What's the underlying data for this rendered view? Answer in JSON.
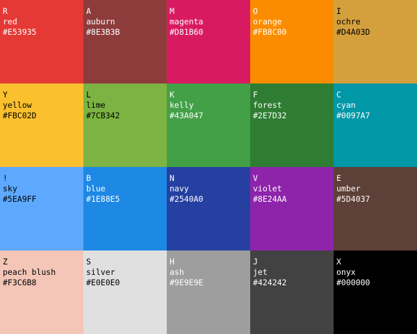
{
  "palette": {
    "swatches": [
      {
        "key": "R",
        "name": "red",
        "hex": "#E53935",
        "text_color": "#FFFFFF"
      },
      {
        "key": "A",
        "name": "auburn",
        "hex": "#8E3B3B",
        "text_color": "#FFFFFF"
      },
      {
        "key": "M",
        "name": "magenta",
        "hex": "#D81B60",
        "text_color": "#FFFFFF"
      },
      {
        "key": "O",
        "name": "orange",
        "hex": "#FB8C00",
        "text_color": "#FFFFFF"
      },
      {
        "key": "I",
        "name": "ochre",
        "hex": "#D4A03D",
        "text_color": "#000000"
      },
      {
        "key": "Y",
        "name": "yellow",
        "hex": "#FBC02D",
        "text_color": "#000000"
      },
      {
        "key": "L",
        "name": "lime",
        "hex": "#7CB342",
        "text_color": "#000000"
      },
      {
        "key": "K",
        "name": "kelly",
        "hex": "#43A047",
        "text_color": "#FFFFFF"
      },
      {
        "key": "F",
        "name": "forest",
        "hex": "#2E7D32",
        "text_color": "#FFFFFF"
      },
      {
        "key": "C",
        "name": "cyan",
        "hex": "#0097A7",
        "text_color": "#FFFFFF"
      },
      {
        "key": "!",
        "name": "sky",
        "hex": "#5EA9FF",
        "text_color": "#000000"
      },
      {
        "key": "B",
        "name": "blue",
        "hex": "#1E88E5",
        "text_color": "#FFFFFF"
      },
      {
        "key": "N",
        "name": "navy",
        "hex": "#2540A0",
        "text_color": "#FFFFFF"
      },
      {
        "key": "V",
        "name": "violet",
        "hex": "#8E24AA",
        "text_color": "#FFFFFF"
      },
      {
        "key": "E",
        "name": "umber",
        "hex": "#5D4037",
        "text_color": "#FFFFFF"
      },
      {
        "key": "Z",
        "name": "peach blush",
        "hex": "#F3C6B8",
        "text_color": "#000000"
      },
      {
        "key": "S",
        "name": "silver",
        "hex": "#E0E0E0",
        "text_color": "#000000"
      },
      {
        "key": "H",
        "name": "ash",
        "hex": "#9E9E9E",
        "text_color": "#FFFFFF"
      },
      {
        "key": "J",
        "name": "jet",
        "hex": "#424242",
        "text_color": "#FFFFFF"
      },
      {
        "key": "X",
        "name": "onyx",
        "hex": "#000000",
        "text_color": "#FFFFFF"
      }
    ]
  }
}
